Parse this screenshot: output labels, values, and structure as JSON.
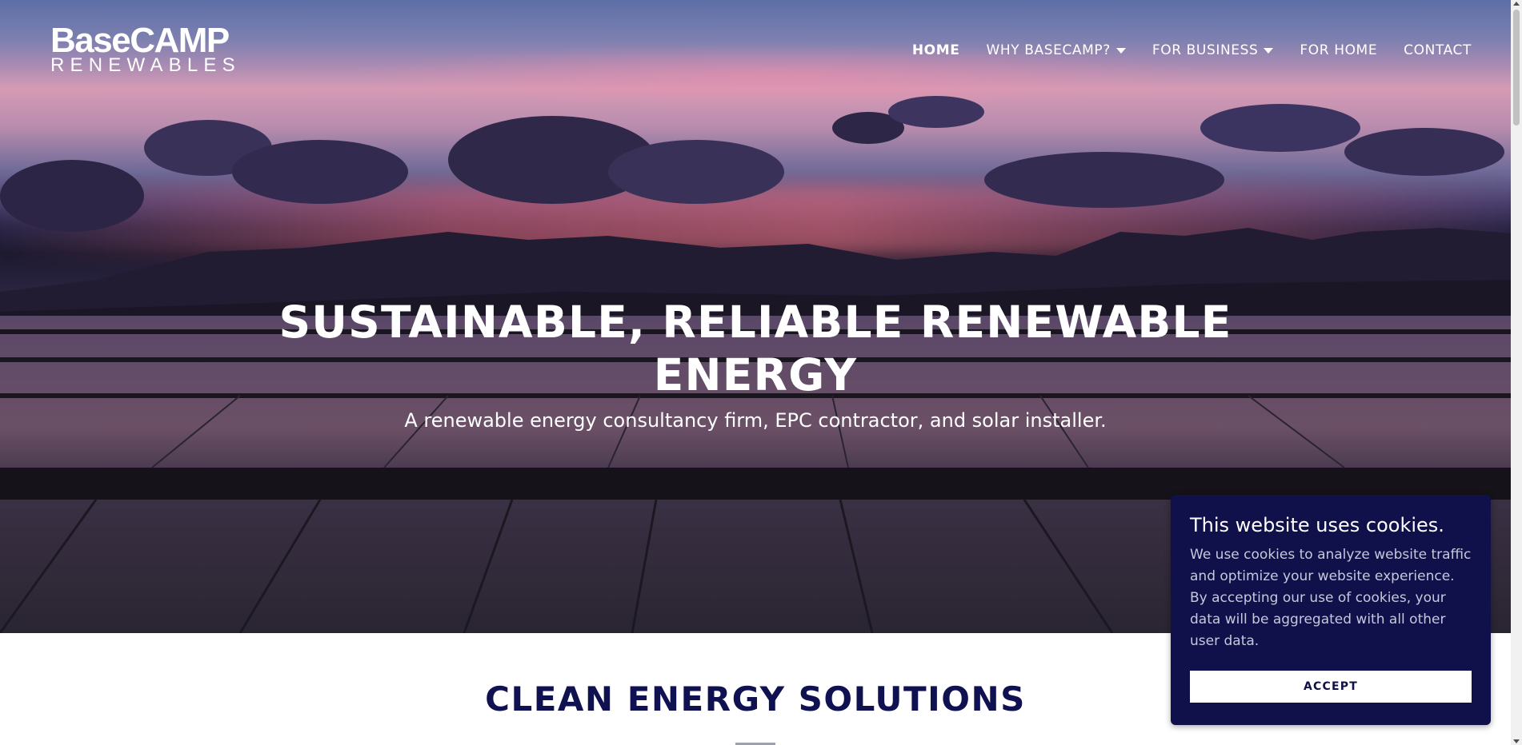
{
  "header": {
    "logo_line1": "BaseCAMP",
    "logo_line2": "RENEWABLES",
    "nav": [
      {
        "label": "HOME",
        "active": true
      },
      {
        "label": "WHY BASECAMP?",
        "dropdown": true
      },
      {
        "label": "FOR BUSINESS",
        "dropdown": true
      },
      {
        "label": "FOR HOME"
      },
      {
        "label": "CONTACT"
      }
    ]
  },
  "hero": {
    "title_line1": "SUSTAINABLE, RELIABLE RENEWABLE",
    "title_line2": "ENERGY",
    "subtitle": "A renewable energy consultancy firm, EPC contractor, and solar installer."
  },
  "section": {
    "title": "CLEAN ENERGY SOLUTIONS"
  },
  "cookie_banner": {
    "title": "This website uses cookies.",
    "body": "We use cookies to analyze website traffic and optimize your website experience. By accepting our use of cookies, your data will be aggregated with all other user data.",
    "accept_label": "ACCEPT"
  },
  "colors": {
    "brand_navy": "#10104a",
    "heading_navy": "#0f1150",
    "white": "#ffffff"
  },
  "icons": {
    "dropdown": "caret-down-icon"
  }
}
